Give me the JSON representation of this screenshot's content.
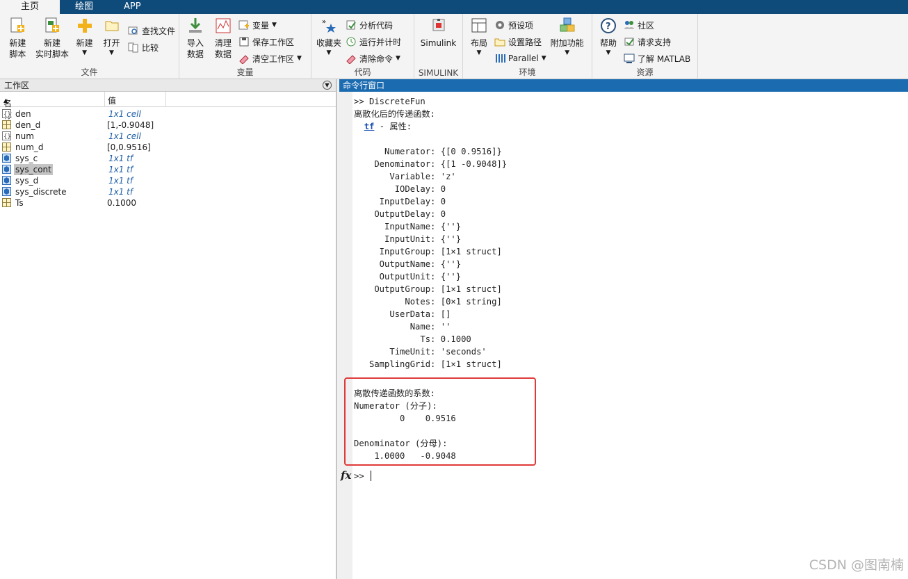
{
  "tabs": [
    "主页",
    "绘图",
    "APP"
  ],
  "ribbon": {
    "file": {
      "new_script": "新建\n脚本",
      "new_live": "新建\n实时脚本",
      "new": "新建",
      "open": "打开",
      "find_files": "查找文件",
      "compare": "比较",
      "label": "文件"
    },
    "variable": {
      "import": "导入\n数据",
      "clean": "清理\n数据",
      "variable": "变量",
      "save_ws": "保存工作区",
      "clear_ws": "清空工作区",
      "label": "变量"
    },
    "code": {
      "favorites": "收藏夹",
      "analyze": "分析代码",
      "run_time": "运行并计时",
      "clear_cmd": "清除命令",
      "label": "代码"
    },
    "simulink": {
      "button": "Simulink",
      "label": "SIMULINK"
    },
    "env": {
      "layout": "布局",
      "prefs": "预设项",
      "set_path": "设置路径",
      "parallel": "Parallel",
      "addons": "附加功能",
      "label": "环境"
    },
    "resources": {
      "help": "帮助",
      "community": "社区",
      "support": "请求支持",
      "learn": "了解 MATLAB",
      "label": "资源"
    }
  },
  "workspace": {
    "title": "工作区",
    "col_name": "名称",
    "col_value": "值",
    "vars": [
      {
        "name": "den",
        "value": "1x1 cell",
        "icon": "cell"
      },
      {
        "name": "den_d",
        "value": "[1,-0.9048]",
        "icon": "matrix"
      },
      {
        "name": "num",
        "value": "1x1 cell",
        "icon": "cell"
      },
      {
        "name": "num_d",
        "value": "[0,0.9516]",
        "icon": "matrix"
      },
      {
        "name": "sys_c",
        "value": "1x1 tf",
        "icon": "object"
      },
      {
        "name": "sys_cont",
        "value": "1x1 tf",
        "icon": "object"
      },
      {
        "name": "sys_d",
        "value": "1x1 tf",
        "icon": "object"
      },
      {
        "name": "sys_discrete",
        "value": "1x1 tf",
        "icon": "object"
      },
      {
        "name": "Ts",
        "value": "0.1000",
        "icon": "matrix"
      }
    ]
  },
  "command": {
    "title": "命令行窗口",
    "lines": [
      ">> DiscreteFun",
      "离散化后的传递函数:",
      "  tf - 属性:",
      "",
      "      Numerator: {[0 0.9516]}",
      "    Denominator: {[1 -0.9048]}",
      "       Variable: 'z'",
      "        IODelay: 0",
      "     InputDelay: 0",
      "    OutputDelay: 0",
      "      InputName: {''}",
      "      InputUnit: {''}",
      "     InputGroup: [1×1 struct]",
      "     OutputName: {''}",
      "     OutputUnit: {''}",
      "    OutputGroup: [1×1 struct]",
      "          Notes: [0×1 string]",
      "       UserData: []",
      "           Name: ''",
      "             Ts: 0.1000",
      "       TimeUnit: 'seconds'",
      "   SamplingGrid: [1×1 struct]",
      "",
      "离散传递函数的系数:",
      "Numerator (分子):",
      "         0    0.9516",
      "",
      "Denominator (分母):",
      "    1.0000   -0.9048"
    ],
    "prompt": ">>"
  },
  "watermark": "CSDN @图南楠"
}
